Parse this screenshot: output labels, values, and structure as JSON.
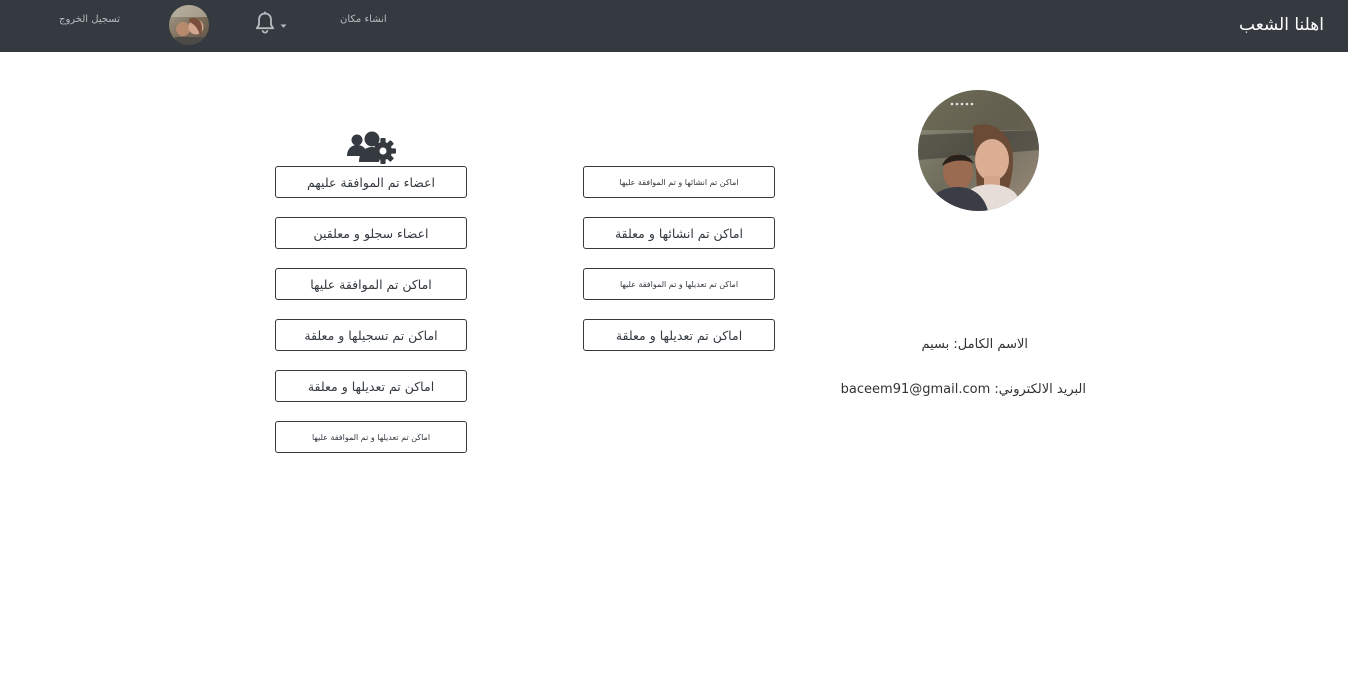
{
  "navbar": {
    "brand": "اهلنا الشعب",
    "create_place": "انشاء مكان",
    "logout": "تسجيل الخروج",
    "bell_icon": "bell-icon",
    "dropdown_icon": "caret-down-icon"
  },
  "profile": {
    "full_name_label": "الاسم الكامل:",
    "full_name": "بسيم",
    "email_label": "البريد الالكتروني:",
    "email": "baceem91@gmail.com",
    "name_line": "الاسم الكامل: بسيم",
    "email_line": "البريد الالكتروني: baceem91@gmail.com"
  },
  "admin": {
    "icon": "users-cog-icon",
    "buttons": [
      "اعضاء تم الموافقة عليهم",
      "اعضاء سجلو و معلقين",
      "اماكن تم الموافقة عليها",
      "اماكن تم تسجيلها و معلقة",
      "اماكن تم تعديلها و معلقة",
      "اماكن تم تعديلها و تم الموافقة عليها"
    ]
  },
  "user_places": {
    "buttons": [
      "اماكن تم انشائها و تم الموافقة عليها",
      "اماكن تم انشائها و معلقة",
      "اماكن تم تعديلها و تم الموافقة عليها",
      "اماكن تم تعديلها و معلقة"
    ]
  },
  "colors": {
    "navbar_bg": "#343a40",
    "button_border": "#343a40",
    "page_bg": "#ffffff"
  }
}
